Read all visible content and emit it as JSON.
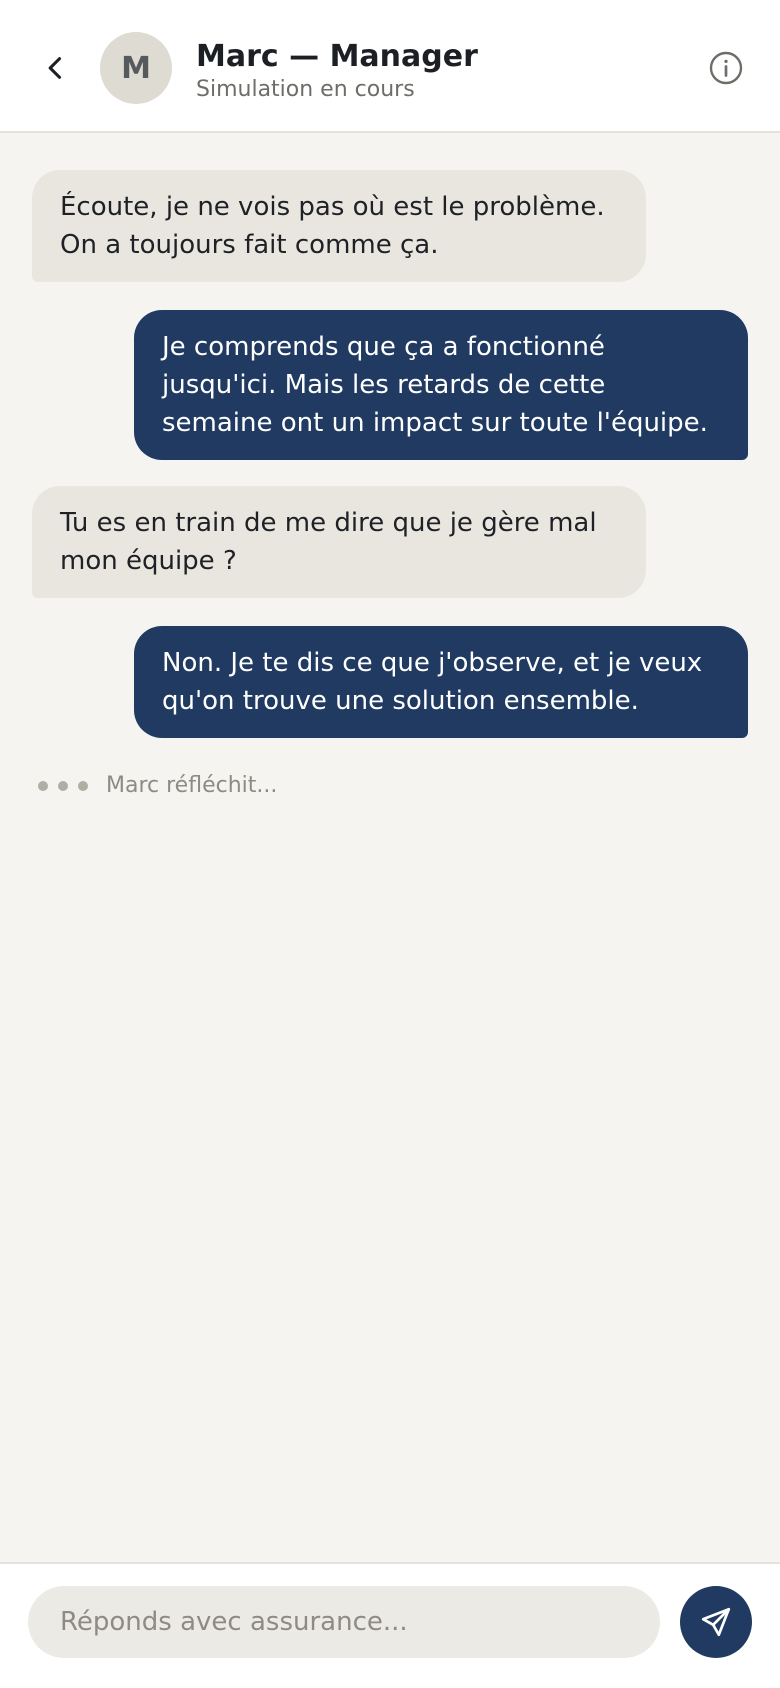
{
  "header": {
    "back_icon": "chevron-left-icon",
    "avatar_initial": "M",
    "title": "Marc — Manager",
    "subtitle": "Simulation en cours",
    "info_icon": "info-icon"
  },
  "messages": [
    {
      "from": "contact",
      "text": "Écoute, je ne vois pas où est le problème. On a toujours fait comme ça."
    },
    {
      "from": "user",
      "text": "Je comprends que ça a fonctionné jusqu'ici. Mais les retards de cette semaine ont un impact sur toute l'équipe."
    },
    {
      "from": "contact",
      "text": "Tu es en train de me dire que je gère mal mon équipe ?"
    },
    {
      "from": "user",
      "text": "Non. Je te dis ce que j'observe, et je veux qu'on trouve une solution ensemble."
    }
  ],
  "typing": {
    "text": "Marc réfléchit..."
  },
  "composer": {
    "placeholder": "Réponds avec assurance...",
    "value": "",
    "send_icon": "send-icon"
  },
  "colors": {
    "accent": "#203a61",
    "incoming_bubble": "#e9e6df",
    "background": "#f5f4f0"
  }
}
